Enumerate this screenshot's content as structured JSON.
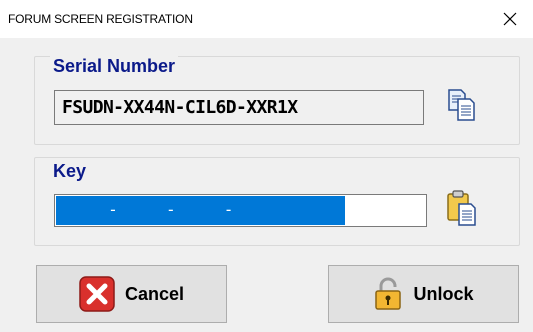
{
  "window": {
    "title": "FORUM SCREEN REGISTRATION",
    "close_glyph": "✕"
  },
  "serial": {
    "label": "Serial Number",
    "value": "FSUDN-XX44N-CIL6D-XXR1X",
    "copy_icon": "copy-icon"
  },
  "key": {
    "label": "Key",
    "value": "     -     -     -     ",
    "paste_icon": "paste-icon"
  },
  "buttons": {
    "cancel_label": "Cancel",
    "cancel_icon": "red-x-icon",
    "unlock_label": "Unlock",
    "unlock_icon": "padlock-icon"
  },
  "colors": {
    "label_blue": "#0b1a8a",
    "selection_blue": "#0078d7",
    "cancel_red": "#d9302c"
  }
}
